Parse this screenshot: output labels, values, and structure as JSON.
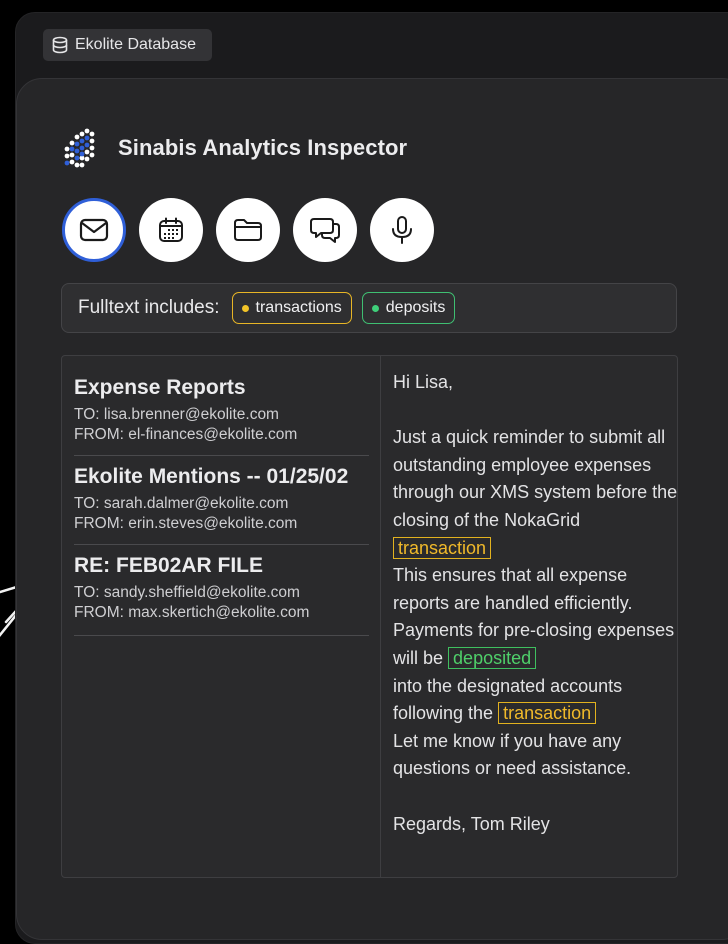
{
  "workspace": {
    "tag_label": "Ekolite Database"
  },
  "app": {
    "title": "Sinabis Analytics Inspector"
  },
  "toolbar": {
    "icons": [
      {
        "name": "mail-icon",
        "active": true
      },
      {
        "name": "calendar-icon",
        "active": false
      },
      {
        "name": "folder-icon",
        "active": false
      },
      {
        "name": "chat-icon",
        "active": false
      },
      {
        "name": "microphone-icon",
        "active": false
      }
    ]
  },
  "filter": {
    "label": "Fulltext includes:",
    "chips": [
      {
        "label": "transactions",
        "color": "#f2c428"
      },
      {
        "label": "deposits",
        "color": "#3fcf7a"
      }
    ]
  },
  "emails": [
    {
      "subject": "Expense Reports",
      "to": "TO: lisa.brenner@ekolite.com",
      "from": "FROM: el-finances@ekolite.com"
    },
    {
      "subject": "Ekolite Mentions -- 01/25/02",
      "to": "TO: sarah.dalmer@ekolite.com",
      "from": "FROM: erin.steves@ekolite.com"
    },
    {
      "subject": "RE: FEB02AR FILE",
      "to": "TO: sandy.sheffield@ekolite.com",
      "from": "FROM: max.skertich@ekolite.com"
    }
  ],
  "message": {
    "greeting": "Hi Lisa,",
    "p1": "Just a quick reminder to submit all outstanding employee expenses through our XMS system before the closing of the NokaGrid",
    "hl1": "transaction",
    "p2": "This ensures that all expense reports are handled efficiently. Payments for pre-closing expenses will be",
    "hl2": "deposited",
    "p3": "into the designated accounts following the",
    "hl3": "transaction",
    "p4": "Let me know if you have any questions or need assistance.",
    "signoff": "Regards, Tom Riley"
  },
  "colors": {
    "accent_blue": "#2f5fd8",
    "highlight_yellow": "#e2b21f",
    "highlight_green": "#3fbf5f"
  }
}
